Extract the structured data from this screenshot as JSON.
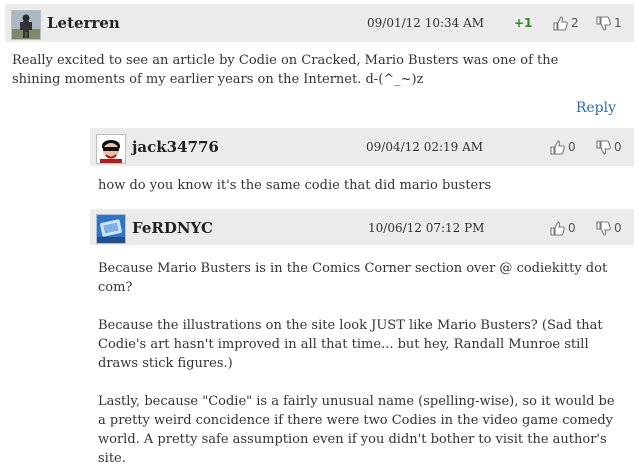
{
  "comments": [
    {
      "username": "Leterren",
      "date": "09/01/12 10:34 AM",
      "score": "+1",
      "likes": "2",
      "dislikes": "1",
      "paragraphs": [
        "Really excited to see an article by Codie on Cracked, Mario Busters was one of the shining moments of my earlier years on the Internet. d-(^_~)z"
      ],
      "reply_label": "Reply"
    },
    {
      "username": "jack34776",
      "date": "09/04/12 02:19 AM",
      "likes": "0",
      "dislikes": "0",
      "paragraphs": [
        "how do you know it's the same codie that did mario busters"
      ]
    },
    {
      "username": "FeRDNYC",
      "date": "10/06/12 07:12 PM",
      "likes": "0",
      "dislikes": "0",
      "paragraphs": [
        "Because Mario Busters is in the Comics Corner section over @ codiekitty dot com?",
        "Because the illustrations on the site look JUST like Mario Busters? (Sad that Codie's art hasn't improved in all that time... but hey, Randall Munroe still draws stick figures.)",
        "Lastly, because \"Codie\" is a fairly unusual name (spelling-wise), so it would be a pretty weird concidence if there were two Codies in the video game comedy world. A pretty safe assumption even if you didn't bother to visit the author's site."
      ]
    }
  ],
  "icons": {
    "like": "thumbs-up-icon",
    "dislike": "thumbs-down-icon"
  },
  "colors": {
    "header_bg": "#ebebeb",
    "score_green": "#2e8b24",
    "link_blue": "#2a6bb5"
  }
}
